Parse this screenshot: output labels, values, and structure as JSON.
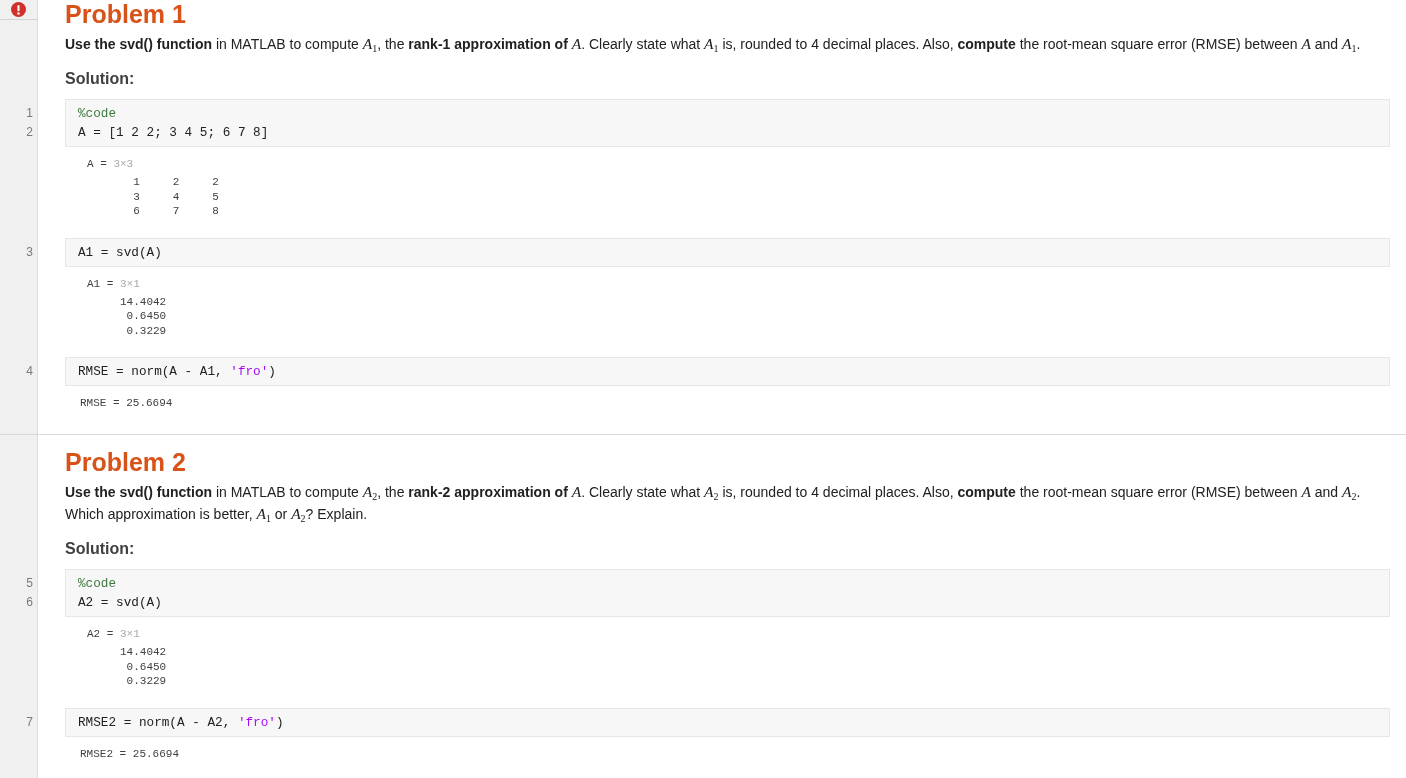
{
  "sections": [
    {
      "title": "Problem 1",
      "error": true,
      "prompt": "**Use the svd() function** in MATLAB to compute *A*$_{1}$, the **rank-1 approximation of** *A*. Clearly state what *A*$_{1}$ is, rounded to 4 decimal places. Also, **compute** the root-mean square error (RMSE) between *A* and *A*$_{1}$.",
      "solution_label": "Solution:",
      "blocks": [
        {
          "kind": "code",
          "lines": [
            {
              "number": "1",
              "tokens": [
                {
                  "kind": "comment",
                  "text": "%code"
                }
              ]
            },
            {
              "number": "2",
              "tokens": [
                {
                  "kind": "plain",
                  "text": "A = [1 2 2; 3 4 5; 6 7 8]"
                }
              ]
            }
          ]
        },
        {
          "kind": "matrix",
          "label": "A =",
          "size": "3×3",
          "rows": [
            [
              "1",
              "2",
              "2"
            ],
            [
              "3",
              "4",
              "5"
            ],
            [
              "6",
              "7",
              "8"
            ]
          ]
        },
        {
          "kind": "code",
          "lines": [
            {
              "number": "3",
              "tokens": [
                {
                  "kind": "plain",
                  "text": "A1 = svd(A)"
                }
              ]
            }
          ]
        },
        {
          "kind": "matrix",
          "label": "A1 =",
          "size": "3×1",
          "rows": [
            [
              "14.4042"
            ],
            [
              "0.6450"
            ],
            [
              "0.3229"
            ]
          ]
        },
        {
          "kind": "code",
          "lines": [
            {
              "number": "4",
              "tokens": [
                {
                  "kind": "plain",
                  "text": "RMSE = norm(A - A1, "
                },
                {
                  "kind": "string",
                  "text": "'fro'"
                },
                {
                  "kind": "plain",
                  "text": ")"
                }
              ]
            }
          ]
        },
        {
          "kind": "scalar",
          "text": "RMSE = 25.6694"
        }
      ]
    },
    {
      "title": "Problem 2",
      "error": false,
      "prompt": "**Use the svd() function** in MATLAB to compute *A*$_{2}$, the **rank-2 approximation of** *A*. Clearly state what *A*$_{2}$ is, rounded to 4 decimal places. Also, **compute** the root-mean square error (RMSE) between *A* and *A*$_{2}$. Which approximation is better, *A*$_{1}$ or *A*$_{2}$? Explain.",
      "solution_label": "Solution:",
      "blocks": [
        {
          "kind": "code",
          "lines": [
            {
              "number": "5",
              "tokens": [
                {
                  "kind": "comment",
                  "text": "%code"
                }
              ]
            },
            {
              "number": "6",
              "tokens": [
                {
                  "kind": "plain",
                  "text": "A2 = svd(A)"
                }
              ]
            }
          ]
        },
        {
          "kind": "matrix",
          "label": "A2 =",
          "size": "3×1",
          "rows": [
            [
              "14.4042"
            ],
            [
              "0.6450"
            ],
            [
              "0.3229"
            ]
          ]
        },
        {
          "kind": "code",
          "lines": [
            {
              "number": "7",
              "tokens": [
                {
                  "kind": "plain",
                  "text": "RMSE2 = norm(A - A2, "
                },
                {
                  "kind": "string",
                  "text": "'fro'"
                },
                {
                  "kind": "plain",
                  "text": ")"
                }
              ]
            }
          ]
        },
        {
          "kind": "scalar",
          "text": "RMSE2 = 25.6694"
        }
      ]
    }
  ]
}
